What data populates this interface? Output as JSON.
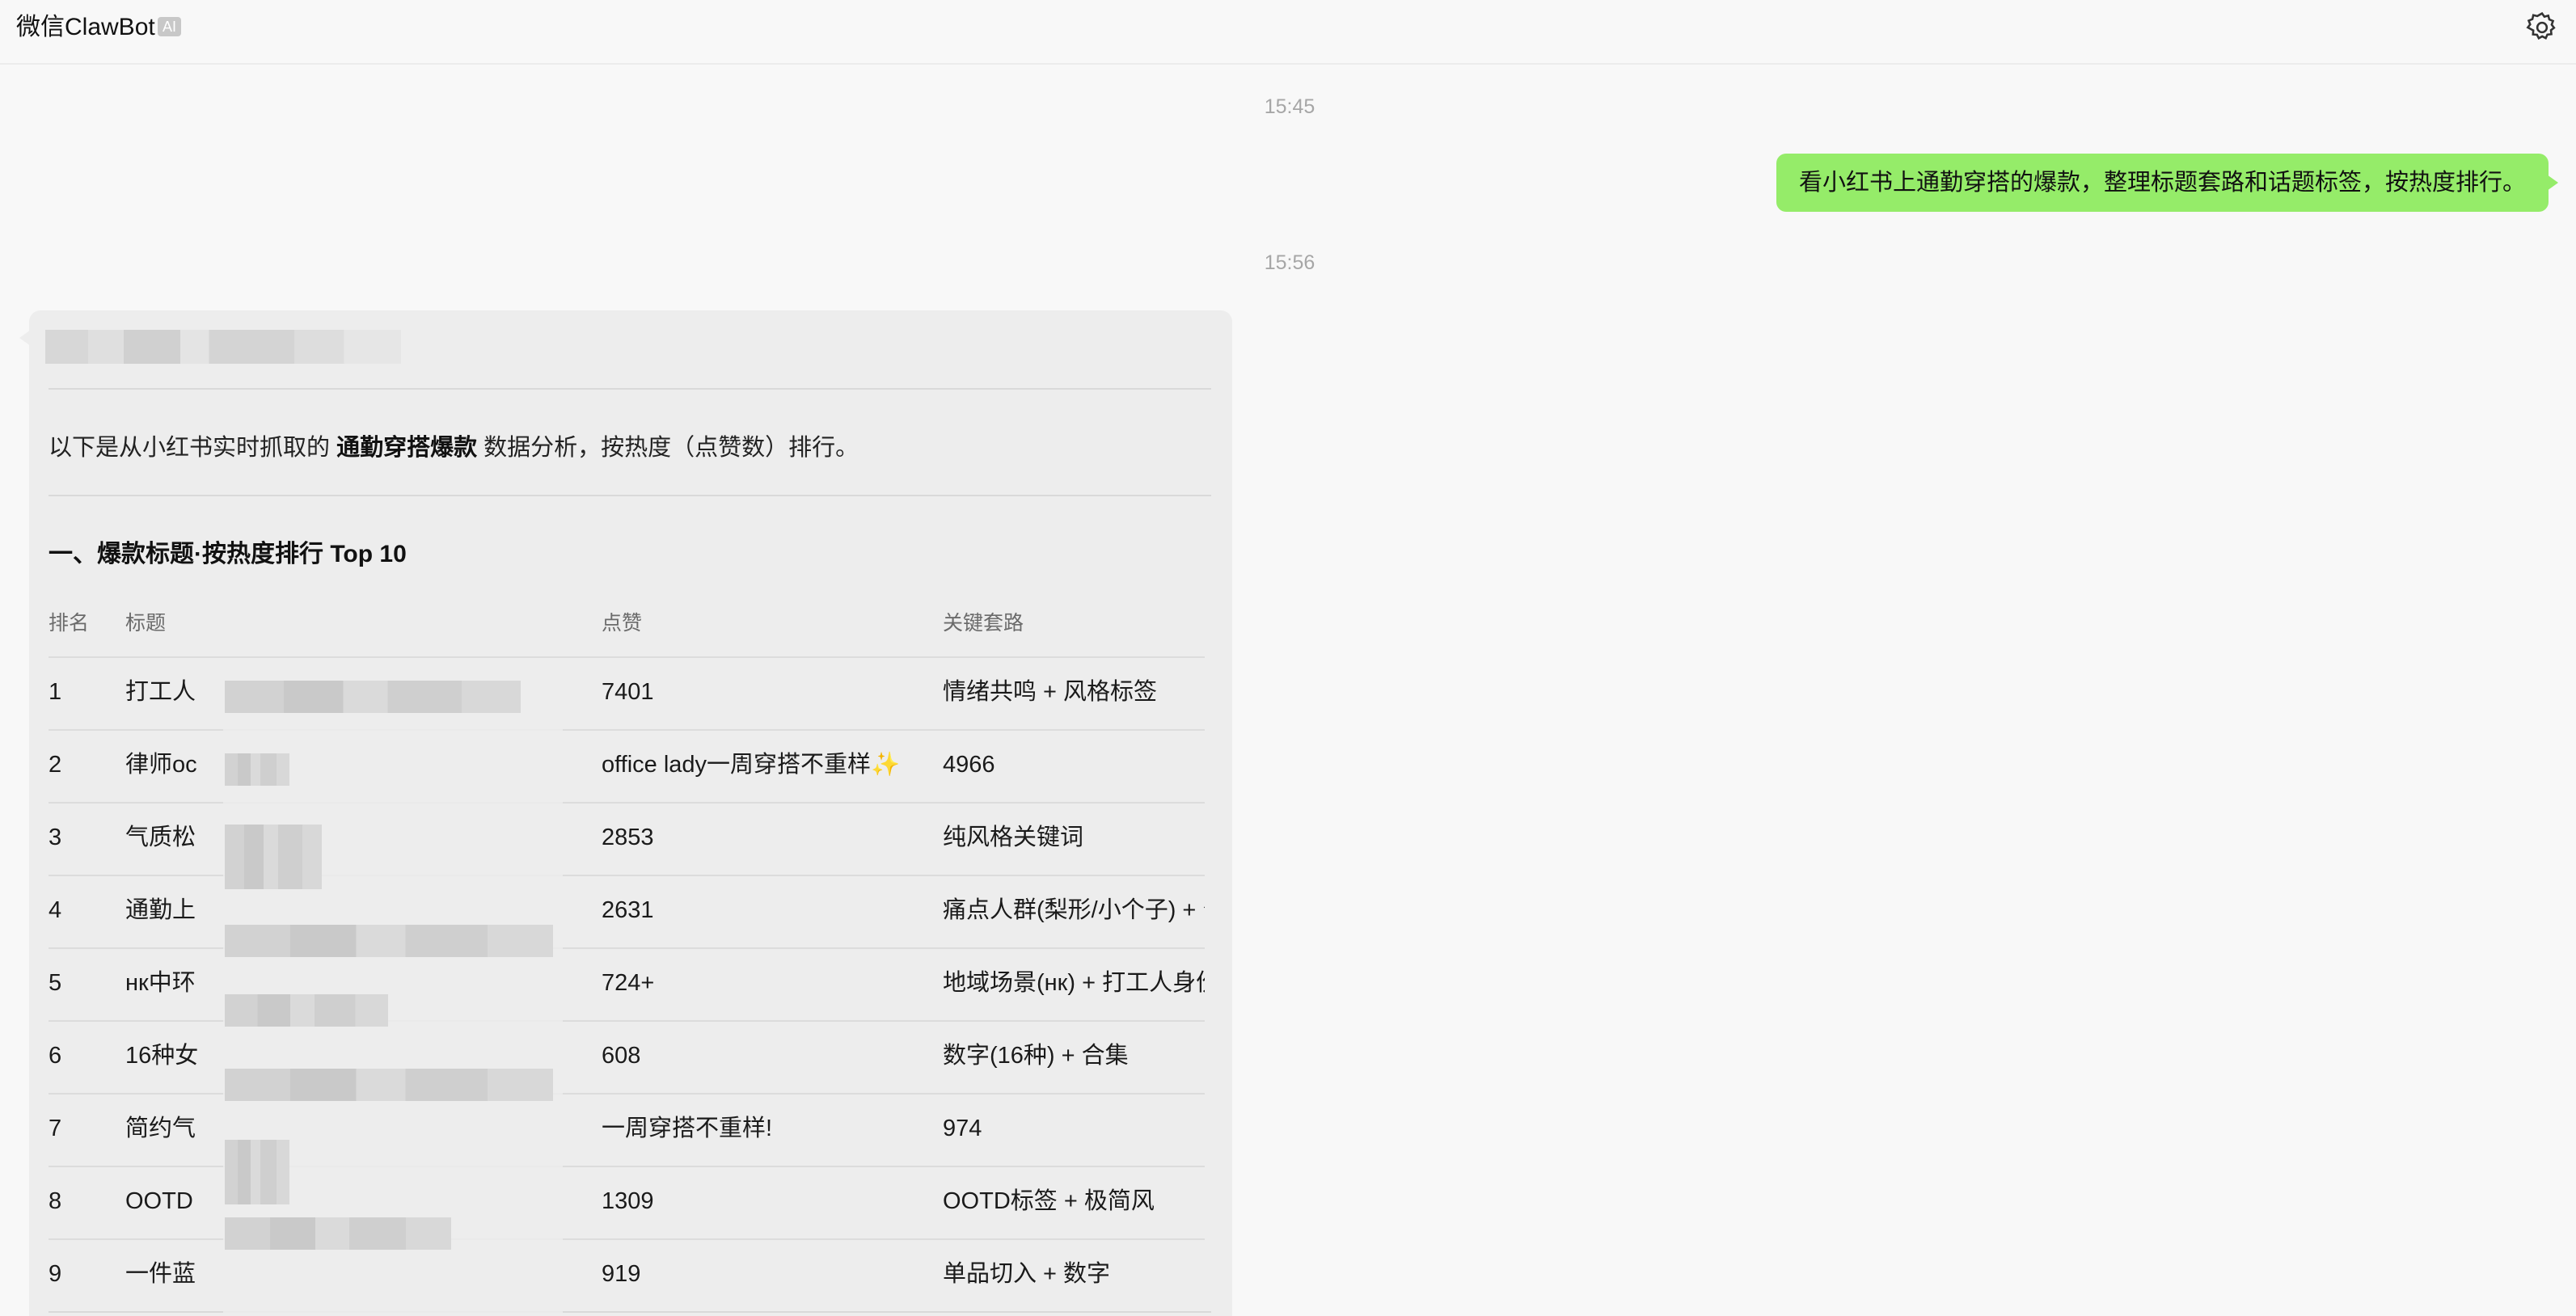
{
  "header": {
    "title": "微信ClawBot",
    "badge": "AI",
    "settings_icon": "gear-icon"
  },
  "messages": {
    "timestamp_1": "15:45",
    "user_message": "看小红书上通勤穿搭的爆款，整理标题套路和话题标签，按热度排行。",
    "timestamp_2": "15:56"
  },
  "bot_reply": {
    "intro_prefix": "以下是从小红书实时抓取的 ",
    "intro_bold": "通勤穿搭爆款",
    "intro_suffix": " 数据分析，按热度（点赞数）排行。",
    "section_heading": "一、爆款标题·按热度排行 Top 10",
    "table": {
      "headers": [
        "排名",
        "标题",
        "点赞",
        "关键套路"
      ],
      "rows": [
        {
          "rank": "1",
          "title": "打工人",
          "likes": "7401",
          "key": "情绪共鸣 + 风格标签"
        },
        {
          "rank": "2",
          "title": "律师oc",
          "likes": "office lady一周穿搭不重样✨",
          "key": "4966"
        },
        {
          "rank": "3",
          "title": "气质松",
          "likes": "2853",
          "key": "纯风格关键词"
        },
        {
          "rank": "4",
          "title": "通勤上",
          "likes": "2631",
          "key": "痛点人群(梨形/小个子) + 公"
        },
        {
          "rank": "5",
          "title": "нк中环",
          "likes": "724+",
          "key": "地域场景(нк) + 打工人身份"
        },
        {
          "rank": "6",
          "title": "16种女",
          "likes": "608",
          "key": "数字(16种) + 合集"
        },
        {
          "rank": "7",
          "title": "简约气",
          "likes": "一周穿搭不重样!",
          "key": "974"
        },
        {
          "rank": "8",
          "title": "OOTD",
          "likes": "1309",
          "key": "OOTD标签 + 极简风"
        },
        {
          "rank": "9",
          "title": "一件蓝",
          "likes": "919",
          "key": "单品切入 + 数字"
        }
      ]
    }
  }
}
